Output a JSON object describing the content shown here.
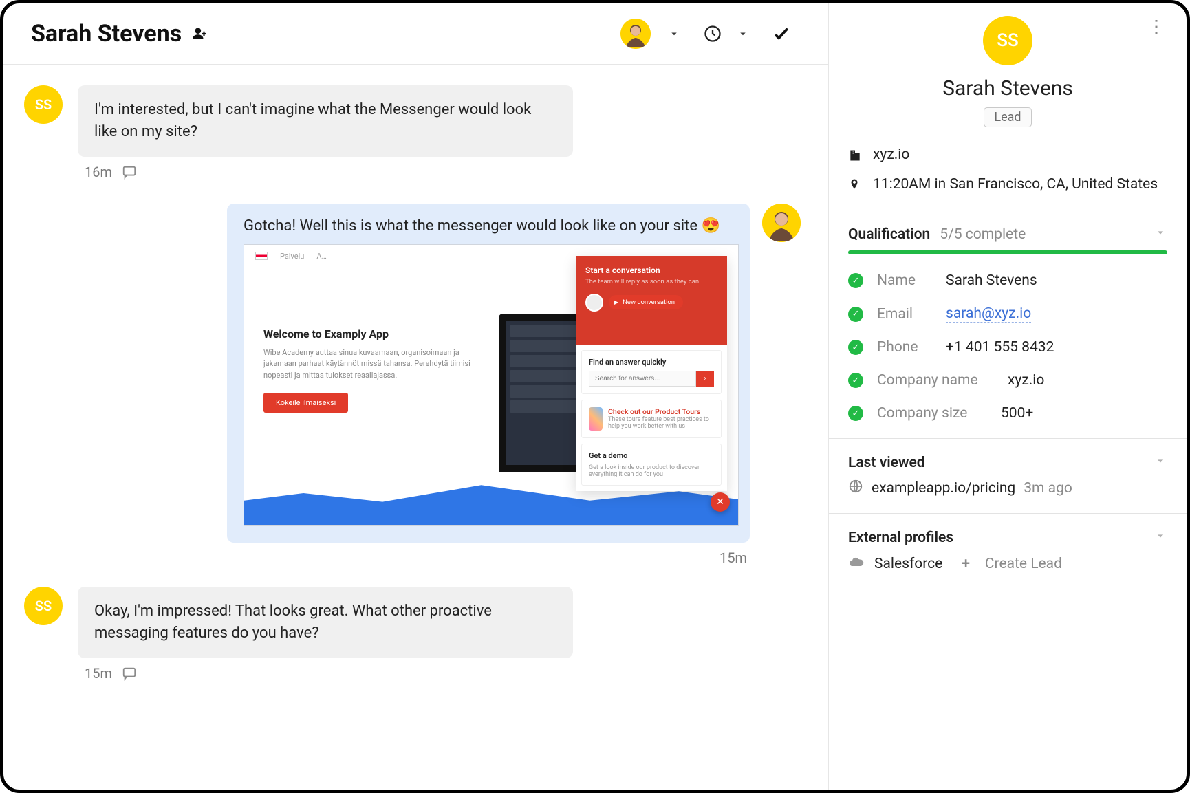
{
  "header": {
    "title": "Sarah Stevens"
  },
  "messages": {
    "m1": {
      "avatar_initials": "SS",
      "text": "I'm interested, but I can't imagine what the Messenger would look like on my site?",
      "meta": "16m"
    },
    "m2": {
      "text": "Gotcha! Well this is what the messenger would look like on your site 😍",
      "meta": "15m",
      "preview": {
        "nav1": "Palvelu",
        "nav2": "A…",
        "hero_title": "Welcome to Examply App",
        "hero_body": "Wibe Academy auttaa sinua kuvaamaan, organisoimaan ja jakamaan parhaat käytännöt missä tahansa. Perehdytä tiimisi nopeasti ja mittaa tulokset reaaliajassa.",
        "hero_cta": "Kokeile ilmaiseksi",
        "panel_title": "Start a conversation",
        "panel_sub": "The team will reply as soon as they can",
        "panel_btn": "New conversation",
        "card_search_title": "Find an answer quickly",
        "card_search_placeholder": "Search for answers...",
        "card_pt_title": "Check out our Product Tours",
        "card_pt_sub": "These tours feature best practices to help you work better with us",
        "card_demo_title": "Get a demo",
        "card_demo_sub": "Get a look inside our product to discover everything it can do for you"
      }
    },
    "m3": {
      "avatar_initials": "SS",
      "text": "Okay, I'm impressed! That looks great. What other proactive messaging features do you have?",
      "meta": "15m"
    }
  },
  "sidebar": {
    "avatar_initials": "SS",
    "name": "Sarah Stevens",
    "badge": "Lead",
    "company_site": "xyz.io",
    "location_line": "11:20AM in San Francisco, CA, United States",
    "qualification": {
      "label": "Qualification",
      "status": "5/5 complete",
      "progress_pct": 100,
      "fields": {
        "name": {
          "label": "Name",
          "value": "Sarah Stevens"
        },
        "email": {
          "label": "Email",
          "value": "sarah@xyz.io"
        },
        "phone": {
          "label": "Phone",
          "value": "+1 401 555 8432"
        },
        "company_name": {
          "label": "Company name",
          "value": "xyz.io"
        },
        "company_size": {
          "label": "Company size",
          "value": "500+"
        }
      }
    },
    "last_viewed": {
      "label": "Last viewed",
      "url": "exampleapp.io/pricing",
      "ago": "3m ago"
    },
    "external": {
      "label": "External profiles",
      "provider": "Salesforce",
      "action": "Create Lead"
    }
  }
}
